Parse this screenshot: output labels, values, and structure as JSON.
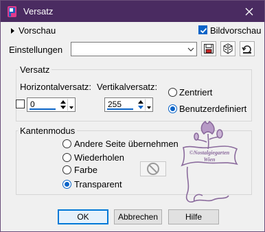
{
  "window": {
    "title": "Versatz"
  },
  "preview": {
    "toggle_label": "Vorschau",
    "checkbox_label": "Bildvorschau",
    "checked": true
  },
  "settings": {
    "label": "Einstellungen",
    "value": ""
  },
  "offset": {
    "group_label": "Versatz",
    "horizontal_label": "Horizontalversatz:",
    "horizontal_value": "0",
    "vertical_label": "Vertikalversatz:",
    "vertical_value": "255",
    "centered_label": "Zentriert",
    "custom_label": "Benutzerdefiniert",
    "selected": "custom"
  },
  "edge_mode": {
    "group_label": "Kantenmodus",
    "options": [
      "Andere Seite übernehmen",
      "Wiederholen",
      "Farbe",
      "Transparent"
    ],
    "selected": "Transparent"
  },
  "watermark": {
    "text_line1": "©Nostalgiegarten",
    "text_line2": "Wien"
  },
  "buttons": {
    "ok": "OK",
    "cancel": "Abbrechen",
    "help": "Hilfe"
  },
  "colors": {
    "titlebar": "#4a2b61",
    "accent": "#0a64c8",
    "watermark": "#8a6a9c"
  }
}
